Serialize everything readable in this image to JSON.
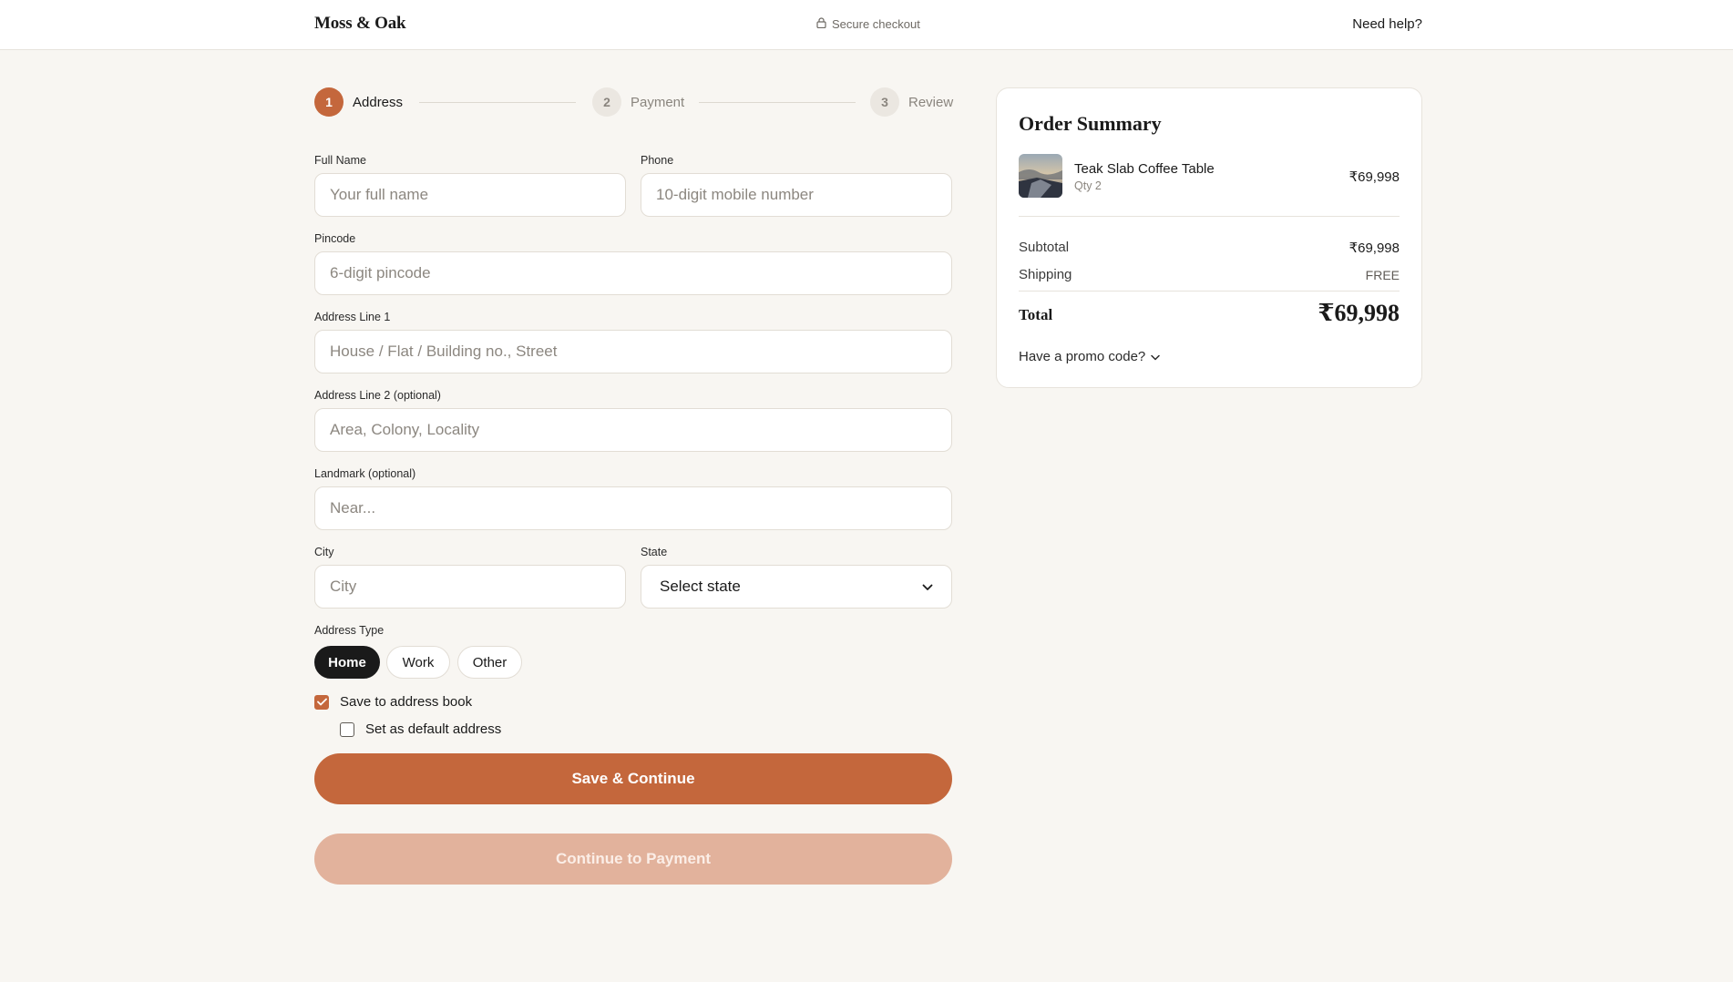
{
  "header": {
    "brand": "Moss & Oak",
    "secure": "Secure checkout",
    "help": "Need help?"
  },
  "stepper": [
    {
      "num": "1",
      "label": "Address",
      "state": "active"
    },
    {
      "num": "2",
      "label": "Payment",
      "state": "inactive"
    },
    {
      "num": "3",
      "label": "Review",
      "state": "inactive"
    }
  ],
  "form": {
    "full_name": {
      "label": "Full Name",
      "value": "",
      "placeholder": "Your full name"
    },
    "phone": {
      "label": "Phone",
      "value": "",
      "placeholder": "10-digit mobile number"
    },
    "pincode": {
      "label": "Pincode",
      "value": "",
      "placeholder": "6-digit pincode"
    },
    "address1": {
      "label": "Address Line 1",
      "value": "",
      "placeholder": "House / Flat / Building no., Street"
    },
    "address2": {
      "label": "Address Line 2 (optional)",
      "value": "",
      "placeholder": "Area, Colony, Locality"
    },
    "landmark": {
      "label": "Landmark (optional)",
      "value": "",
      "placeholder": "Near..."
    },
    "city": {
      "label": "City",
      "value": "",
      "placeholder": "City"
    },
    "state": {
      "label": "State",
      "selected": "Select state"
    },
    "address_type": {
      "label": "Address Type",
      "options": [
        "Home",
        "Work",
        "Other"
      ],
      "selected": "Home"
    },
    "save_to_book": {
      "label": "Save to address book",
      "checked": true
    },
    "set_default": {
      "label": "Set as default address",
      "checked": false
    },
    "save_continue": "Save & Continue",
    "continue_payment": "Continue to Payment"
  },
  "summary": {
    "title": "Order Summary",
    "item": {
      "name": "Teak Slab Coffee Table",
      "qty": "Qty 2",
      "price": "₹69,998"
    },
    "subtotal_label": "Subtotal",
    "subtotal": "₹69,998",
    "shipping_label": "Shipping",
    "shipping": "FREE",
    "total_label": "Total",
    "total": "₹69,998",
    "promo": "Have a promo code?"
  },
  "colors": {
    "accent": "#c4673c",
    "accent_disabled": "#e2b29c",
    "background": "#f8f6f2",
    "selected_pill": "#1a1a1a"
  },
  "icons": {
    "secure": "lock-icon",
    "select": "chevron-down-icon",
    "promo": "chevron-down-icon",
    "checkbox": "check-icon"
  }
}
